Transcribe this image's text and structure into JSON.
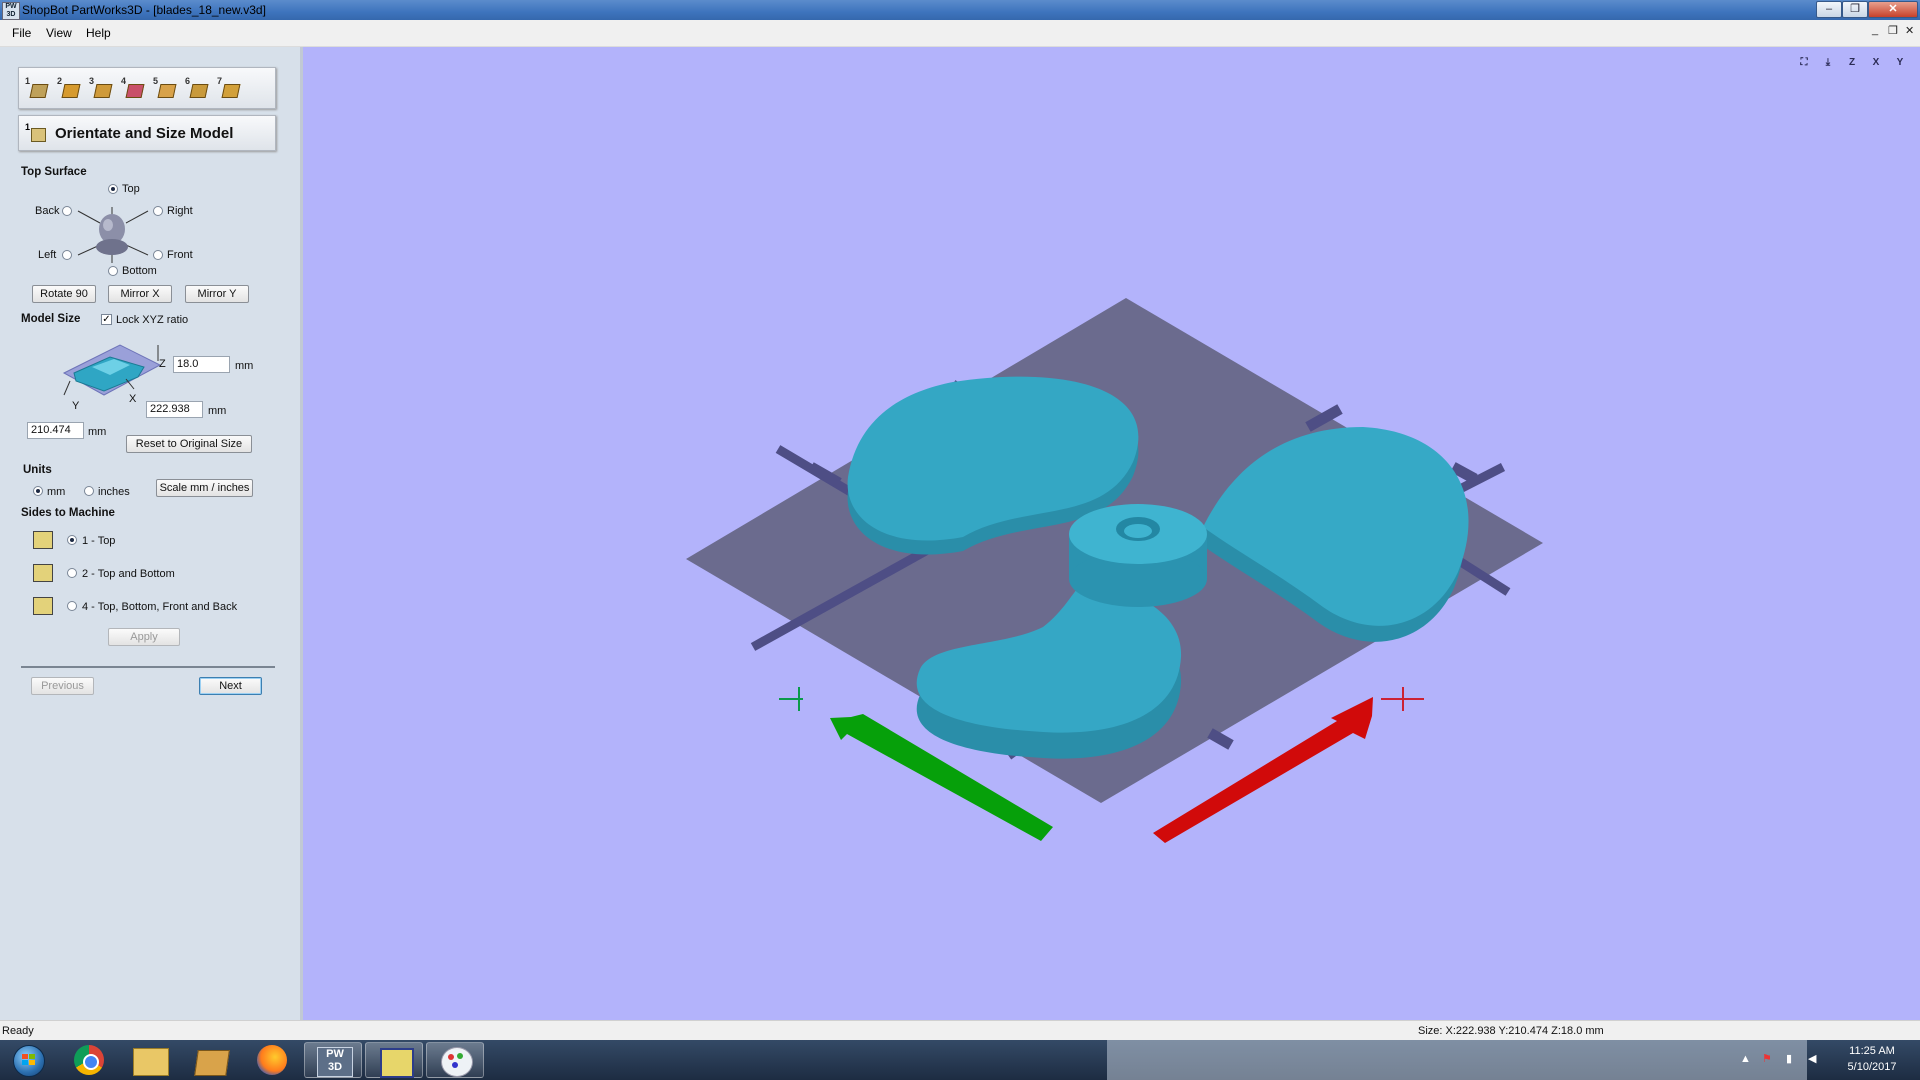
{
  "window": {
    "app_icon_text": "PW 3D",
    "title": "ShopBot PartWorks3D - [blades_18_new.v3d]"
  },
  "menu": {
    "items": [
      "File",
      "View",
      "Help"
    ]
  },
  "wizard": {
    "step_numbers": [
      "1",
      "2",
      "3",
      "4",
      "5",
      "6",
      "7"
    ],
    "current_step_number": "1",
    "current_step_title": "Orientate and Size Model"
  },
  "top_surface": {
    "heading": "Top Surface",
    "options": {
      "top": "Top",
      "back": "Back",
      "right": "Right",
      "left": "Left",
      "front": "Front",
      "bottom": "Bottom"
    },
    "selected": "top",
    "buttons": {
      "rotate": "Rotate 90",
      "mirror_x": "Mirror X",
      "mirror_y": "Mirror Y"
    }
  },
  "model_size": {
    "heading": "Model Size",
    "lock_label": "Lock XYZ ratio",
    "lock_checked": true,
    "axis_z": "Z",
    "axis_x": "X",
    "axis_y": "Y",
    "z_value": "18.0",
    "x_value": "222.938",
    "y_value": "210.474",
    "unit": "mm",
    "reset_button": "Reset to Original Size"
  },
  "units": {
    "heading": "Units",
    "mm": "mm",
    "inches": "inches",
    "selected": "mm",
    "scale_button": "Scale mm / inches"
  },
  "sides": {
    "heading": "Sides to Machine",
    "options": [
      "1 - Top",
      "2 - Top and Bottom",
      "4 - Top, Bottom, Front and Back"
    ],
    "selected_index": 0,
    "apply_button": "Apply"
  },
  "navigation": {
    "previous": "Previous",
    "next": "Next"
  },
  "viewport": {
    "background": "#b3b3fb",
    "model_color": "#2fa6c4",
    "plate_color": "#6b6b8e",
    "tool_labels": [
      "",
      "Z",
      "Z",
      "X",
      "Y"
    ]
  },
  "status": {
    "left": "Ready",
    "right": "Size: X:222.938 Y:210.474 Z:18.0 mm"
  },
  "taskbar": {
    "time": "11:25 AM",
    "date": "5/10/2017",
    "pinned": [
      "chrome-icon",
      "explorer-icon",
      "folder-icon",
      "firefox-icon",
      "partworks3d-icon",
      "vectric-icon",
      "paint-icon"
    ]
  }
}
